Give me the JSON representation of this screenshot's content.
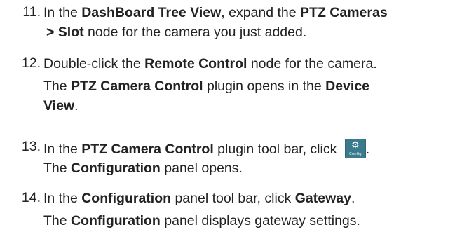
{
  "steps": [
    {
      "number": "11.",
      "lines": [
        {
          "t1": "In the ",
          "b1": "DashBoard Tree View",
          "t2": ", expand the ",
          "b2": "PTZ Cameras"
        },
        {
          "b1": "> Slot",
          "t1": " node for the camera you just added."
        }
      ]
    },
    {
      "number": "12.",
      "lines": [
        {
          "t1": "Double-click the ",
          "b1": "Remote Control",
          "t2": " node for the camera."
        },
        {
          "t1": "The ",
          "b1": "PTZ Camera Control",
          "t2": " plugin opens in the ",
          "b2": "Device"
        },
        {
          "b1": "View",
          "t1": "."
        }
      ]
    },
    {
      "number": "13.",
      "lines": [
        {
          "t1": "In the ",
          "b1": "PTZ Camera Control",
          "t2": " plugin tool bar, click ",
          "after": "."
        },
        {
          "t1": "The ",
          "b1": "Configuration",
          "t2": " panel opens."
        }
      ]
    },
    {
      "number": "14.",
      "lines": [
        {
          "t1": "In the ",
          "b1": "Configuration",
          "t2": " panel tool bar, click ",
          "b2": "Gateway",
          "t3": "."
        },
        {
          "t1": "The ",
          "b1": "Configuration",
          "t2": " panel displays gateway settings."
        }
      ]
    }
  ],
  "config_button": {
    "icon": "gear-icon",
    "caption": "Config",
    "color": "#3a7a8c"
  }
}
